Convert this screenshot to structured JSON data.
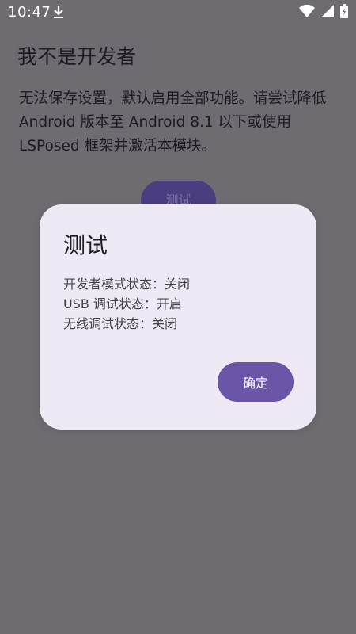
{
  "status_bar": {
    "time": "10:47",
    "icons": [
      "download-icon",
      "wifi-icon",
      "signal-icon",
      "battery-icon"
    ]
  },
  "main": {
    "title": "我不是开发者",
    "description": "无法保存设置，默认启用全部功能。请尝试降低 Android 版本至 Android 8.1 以下或使用 LSPosed 框架并激活本模块。",
    "test_button_label": "测试"
  },
  "dialog": {
    "title": "测试",
    "lines": [
      "开发者模式状态：关闭",
      "USB 调试状态：开启",
      "无线调试状态：关闭"
    ],
    "confirm_label": "确定"
  },
  "colors": {
    "scrim_background": "#6e6c70",
    "dialog_surface": "#eee9f4",
    "primary_button": "#6a55a6"
  }
}
